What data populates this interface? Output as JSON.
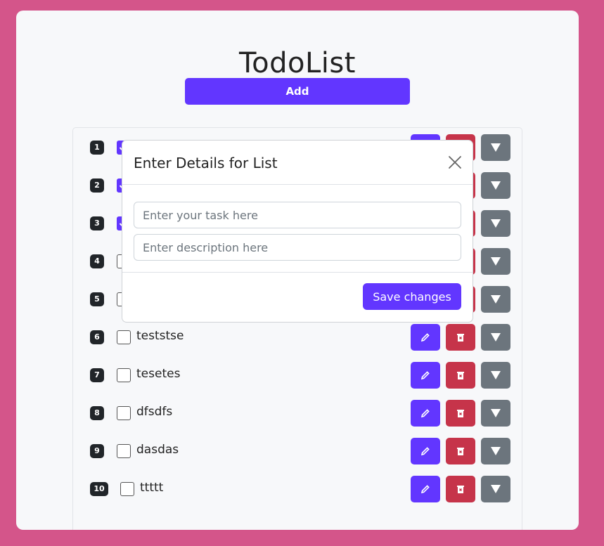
{
  "app": {
    "title": "TodoList",
    "add_label": "Add"
  },
  "tasks": [
    {
      "num": "1",
      "text": "",
      "checked": true
    },
    {
      "num": "2",
      "text": "",
      "checked": true
    },
    {
      "num": "3",
      "text": "",
      "checked": true
    },
    {
      "num": "4",
      "text": "",
      "checked": false
    },
    {
      "num": "5",
      "text": "",
      "checked": false
    },
    {
      "num": "6",
      "text": "teststse",
      "checked": false
    },
    {
      "num": "7",
      "text": "tesetes",
      "checked": false
    },
    {
      "num": "8",
      "text": "dfsdfs",
      "checked": false
    },
    {
      "num": "9",
      "text": "dasdas",
      "checked": false
    },
    {
      "num": "10",
      "text": "ttttt",
      "checked": false
    }
  ],
  "modal": {
    "title": "Enter Details for List",
    "task_placeholder": "Enter your task here",
    "description_placeholder": "Enter description here",
    "save_label": "Save changes"
  },
  "colors": {
    "accent": "#6236ff",
    "danger": "#c6344a",
    "secondary": "#6c757d",
    "background": "#d4558a"
  }
}
